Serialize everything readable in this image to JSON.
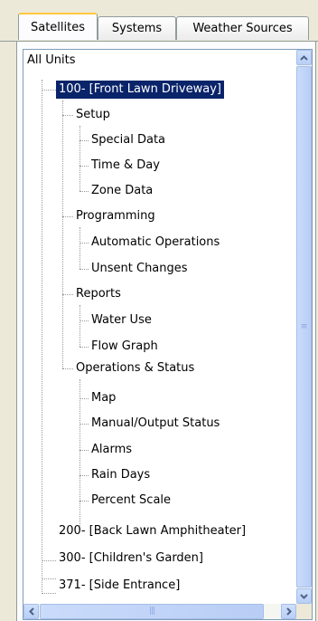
{
  "tabs": [
    {
      "label": "Satellites",
      "active": true
    },
    {
      "label": "Systems",
      "active": false
    },
    {
      "label": "Weather Sources",
      "active": false
    }
  ],
  "tree": {
    "root": "All Units",
    "units": [
      {
        "label": "100- [Front Lawn  Driveway]",
        "selected": true,
        "groups": [
          {
            "label": "Setup",
            "items": [
              "Special Data",
              "Time & Day",
              "Zone Data"
            ]
          },
          {
            "label": "Programming",
            "items": [
              "Automatic Operations",
              "Unsent Changes"
            ]
          },
          {
            "label": "Reports",
            "items": [
              "Water Use",
              "Flow Graph"
            ]
          },
          {
            "label": "Operations & Status",
            "items": [
              "Map",
              "Manual/Output Status",
              "Alarms",
              "Rain Days",
              "Percent Scale"
            ]
          }
        ]
      },
      {
        "label": "200- [Back Lawn  Amphitheater]"
      },
      {
        "label": "300- [Children's Garden]"
      },
      {
        "label": "371- [Side Entrance]"
      }
    ]
  },
  "scrollbar": {
    "up_icon": "arrow-up-icon",
    "down_icon": "arrow-down-icon",
    "left_icon": "arrow-left-icon",
    "right_icon": "arrow-right-icon",
    "grip_icon": "grip-icon"
  },
  "colors": {
    "selection": "#0a246a",
    "tab_highlight": "#ffc83c",
    "border": "#7f9db9"
  }
}
